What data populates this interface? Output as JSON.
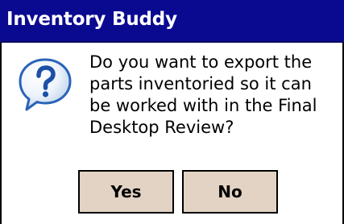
{
  "window": {
    "title": "Inventory Buddy"
  },
  "dialog": {
    "icon": "question-icon",
    "message_lines": [
      "Do you want to export the",
      "parts inventoried so it can",
      "be worked with in the Final",
      "Desktop Review?"
    ],
    "buttons": {
      "yes_label": "Yes",
      "no_label": "No"
    }
  },
  "colors": {
    "title_bar": "#0a0a91",
    "button_face": "#e2d3c4",
    "icon_blue": "#2a63b8"
  }
}
